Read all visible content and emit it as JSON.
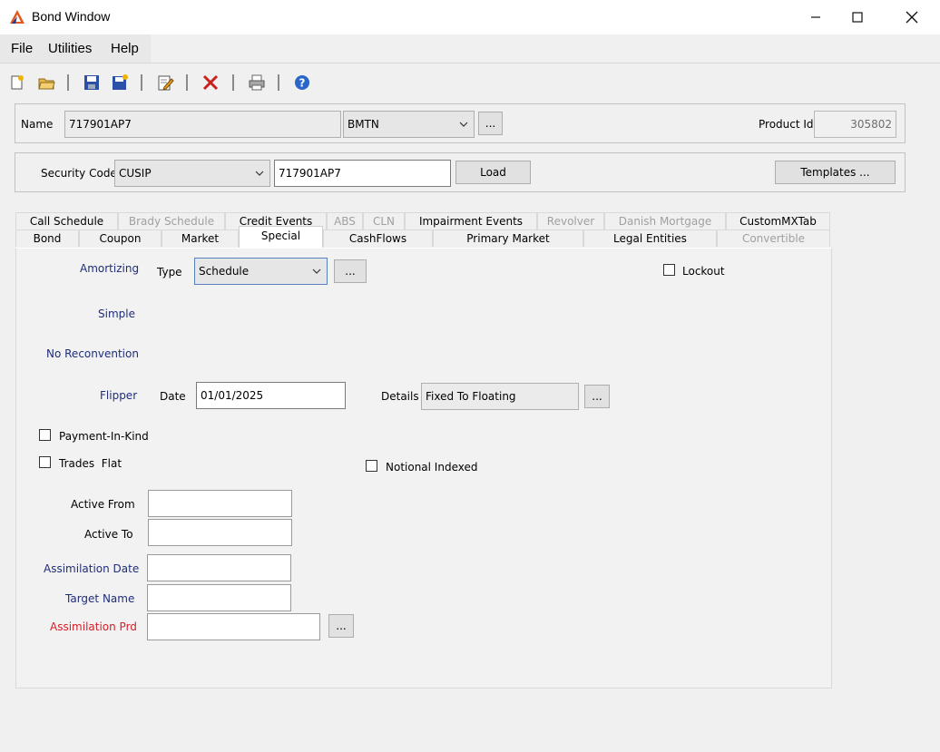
{
  "window": {
    "title": "Bond Window",
    "minimize": "—",
    "maximize": "☐",
    "close": "✕"
  },
  "menu": [
    "File",
    "Utilities",
    "Help"
  ],
  "toolbar": {
    "icons": [
      "new-icon",
      "open-icon",
      "save-icon",
      "save-as-icon",
      "edit-icon",
      "delete-icon",
      "print-icon",
      "help-icon"
    ]
  },
  "name_group": {
    "name_label": "Name",
    "name_value": "717901AP7",
    "type_value": "BMTN",
    "ellipsis": "...",
    "product_id_label": "Product Id",
    "product_id_value": "305802"
  },
  "security_group": {
    "security_code_label": "Security Code",
    "code_type": "CUSIP",
    "code_value": "717901AP7",
    "load": "Load",
    "templates": "Templates ..."
  },
  "tabs": {
    "row1": [
      {
        "label": "Call Schedule",
        "disabled": false
      },
      {
        "label": "Brady Schedule",
        "disabled": true
      },
      {
        "label": "Credit Events",
        "disabled": false
      },
      {
        "label": "ABS",
        "disabled": true
      },
      {
        "label": "CLN",
        "disabled": true
      },
      {
        "label": "Impairment Events",
        "disabled": false
      },
      {
        "label": "Revolver",
        "disabled": true
      },
      {
        "label": "Danish Mortgage",
        "disabled": true
      },
      {
        "label": "CustomMXTab",
        "disabled": false
      }
    ],
    "row2": [
      {
        "label": "Bond",
        "disabled": false
      },
      {
        "label": "Coupon",
        "disabled": false
      },
      {
        "label": "Market",
        "disabled": false
      },
      {
        "label": "Special",
        "disabled": false,
        "selected": true
      },
      {
        "label": "CashFlows",
        "disabled": false
      },
      {
        "label": "Primary Market",
        "disabled": false
      },
      {
        "label": "Legal Entities",
        "disabled": false
      },
      {
        "label": "Convertible",
        "disabled": true
      }
    ]
  },
  "special": {
    "amortizing_label": "Amortizing",
    "type_label": "Type",
    "type_value": "Schedule",
    "lockout_label": "Lockout",
    "simple_label": "Simple",
    "no_reconvention_label": "No Reconvention",
    "flipper_label": "Flipper",
    "date_label": "Date",
    "date_value": "01/01/2025",
    "details_label": "Details",
    "details_value": "Fixed To Floating",
    "payment_in_kind_label": "Payment-In-Kind",
    "trades_flat_label": "Trades  Flat",
    "notional_indexed_label": "Notional Indexed",
    "active_from_label": "Active From",
    "active_from_value": "",
    "active_to_label": "Active To",
    "active_to_value": "",
    "assimilation_date_label": "Assimilation Date",
    "assimilation_date_value": "",
    "target_name_label": "Target Name",
    "target_name_value": "",
    "assimilation_prd_label": "Assimilation Prd",
    "assimilation_prd_value": "",
    "ellipsis": "..."
  },
  "colors": {
    "navy_label": "#1f2d7a",
    "red_label": "#d3202a",
    "disabled_text": "#a0a0a0"
  }
}
